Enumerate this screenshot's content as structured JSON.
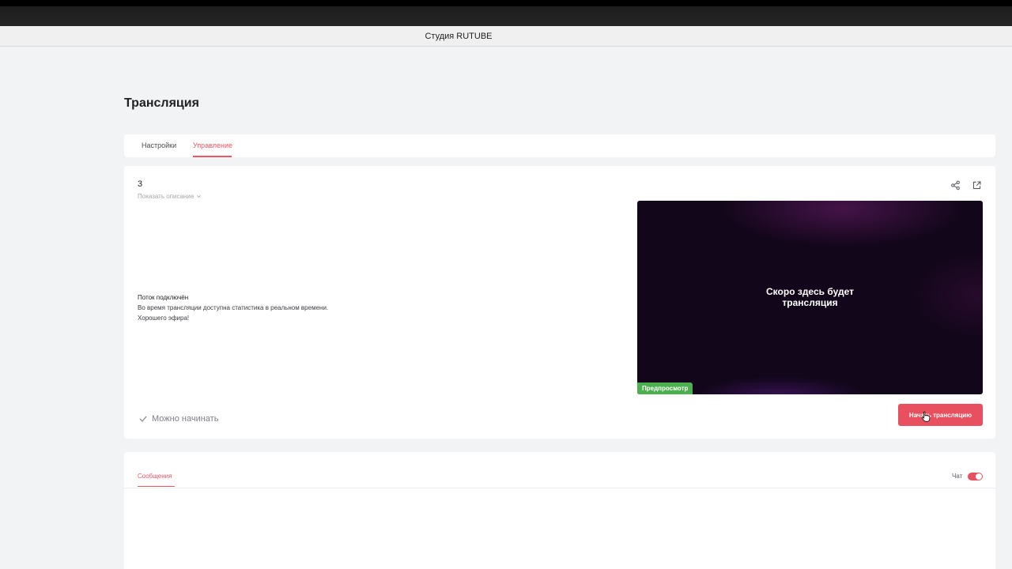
{
  "window": {
    "title": "Студия RUTUBE"
  },
  "page": {
    "title": "Трансляция"
  },
  "tabs": [
    {
      "label": "Настройки",
      "active": false
    },
    {
      "label": "Управление",
      "active": true
    }
  ],
  "stream": {
    "name": "3",
    "show_description": "Показать описание",
    "status_title": "Поток подключён",
    "status_line1": "Во время трансляции доступна статистика в реальном времени.",
    "status_line2": "Хорошего эфира!",
    "preview_text_line1": "Скоро здесь будет",
    "preview_text_line2": "трансляция",
    "preview_badge": "Предпросмотр",
    "ready_text": "Можно начинать",
    "start_button": "Начать трансляцию",
    "icons": {
      "share": "share-icon",
      "open": "external-link-icon",
      "ready": "check-icon"
    }
  },
  "chat": {
    "tab": "Сообщения",
    "toggle_label": "Чат",
    "toggle_on": true
  },
  "colors": {
    "accent": "#e8505f",
    "badge": "#4caf50",
    "page_bg": "#f2f3f5"
  }
}
